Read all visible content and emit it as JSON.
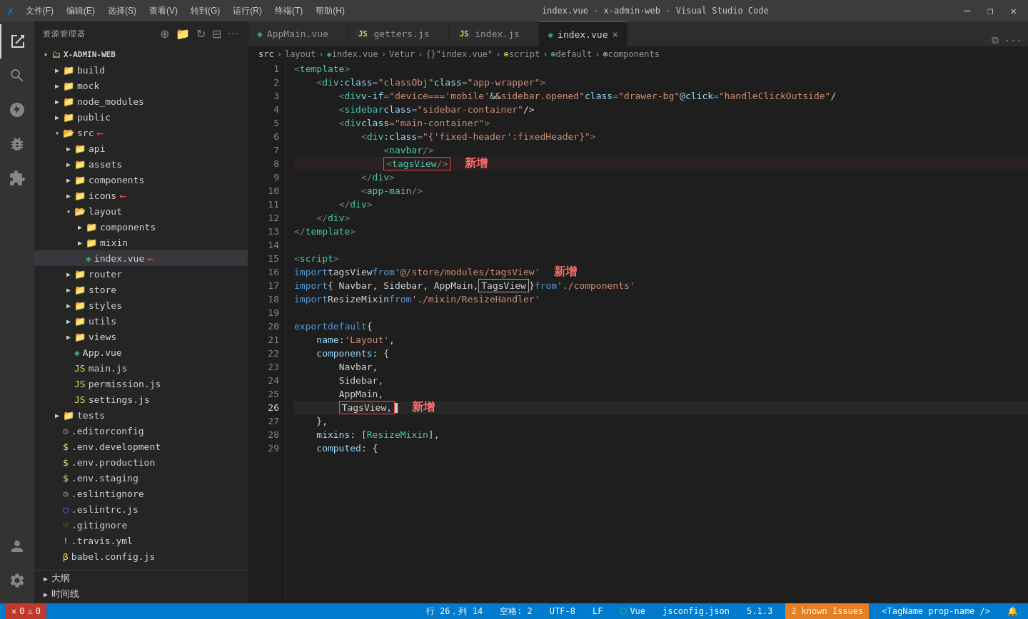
{
  "titlebar": {
    "logo": "✗",
    "menu": [
      "文件(F)",
      "编辑(E)",
      "选择(S)",
      "查看(V)",
      "转到(G)",
      "运行(R)",
      "终端(T)",
      "帮助(H)"
    ],
    "title": "index.vue - x-admin-web - Visual Studio Code",
    "window_controls": [
      "⬜",
      "❐",
      "⬜",
      "✕"
    ]
  },
  "sidebar": {
    "title": "资源管理器",
    "root": "X-ADMIN-WEB",
    "items": [
      {
        "id": "build",
        "label": "build",
        "type": "folder",
        "indent": 1,
        "collapsed": true
      },
      {
        "id": "mock",
        "label": "mock",
        "type": "folder",
        "indent": 1,
        "collapsed": true
      },
      {
        "id": "node_modules",
        "label": "node_modules",
        "type": "folder",
        "indent": 1,
        "collapsed": true
      },
      {
        "id": "public",
        "label": "public",
        "type": "folder",
        "indent": 1,
        "collapsed": true
      },
      {
        "id": "src",
        "label": "src",
        "type": "folder",
        "indent": 1,
        "collapsed": false
      },
      {
        "id": "api",
        "label": "api",
        "type": "folder",
        "indent": 2,
        "collapsed": true
      },
      {
        "id": "assets",
        "label": "assets",
        "type": "folder",
        "indent": 2,
        "collapsed": true
      },
      {
        "id": "components",
        "label": "components",
        "type": "folder",
        "indent": 2,
        "collapsed": true
      },
      {
        "id": "icons",
        "label": "icons",
        "type": "folder",
        "indent": 2,
        "collapsed": true
      },
      {
        "id": "layout",
        "label": "layout",
        "type": "folder",
        "indent": 2,
        "collapsed": false
      },
      {
        "id": "layout-components",
        "label": "components",
        "type": "folder",
        "indent": 3,
        "collapsed": true
      },
      {
        "id": "layout-mixin",
        "label": "mixin",
        "type": "folder",
        "indent": 3,
        "collapsed": true
      },
      {
        "id": "index.vue",
        "label": "index.vue",
        "type": "vue",
        "indent": 3,
        "active": true
      },
      {
        "id": "router",
        "label": "router",
        "type": "folder",
        "indent": 2,
        "collapsed": true
      },
      {
        "id": "store",
        "label": "store",
        "type": "folder",
        "indent": 2,
        "collapsed": true
      },
      {
        "id": "styles",
        "label": "styles",
        "type": "folder",
        "indent": 2,
        "collapsed": true
      },
      {
        "id": "utils",
        "label": "utils",
        "type": "folder",
        "indent": 2,
        "collapsed": true
      },
      {
        "id": "views",
        "label": "views",
        "type": "folder",
        "indent": 2,
        "collapsed": true
      },
      {
        "id": "App.vue",
        "label": "App.vue",
        "type": "vue",
        "indent": 2
      },
      {
        "id": "main.js",
        "label": "main.js",
        "type": "js",
        "indent": 2
      },
      {
        "id": "permission.js",
        "label": "permission.js",
        "type": "js",
        "indent": 2
      },
      {
        "id": "settings.js",
        "label": "settings.js",
        "type": "js",
        "indent": 2
      },
      {
        "id": "tests",
        "label": "tests",
        "type": "folder",
        "indent": 1,
        "collapsed": true
      },
      {
        "id": ".editorconfig",
        "label": ".editorconfig",
        "type": "config",
        "indent": 1
      },
      {
        "id": ".env.development",
        "label": ".env.development",
        "type": "env",
        "indent": 1
      },
      {
        "id": ".env.production",
        "label": ".env.production",
        "type": "env",
        "indent": 1
      },
      {
        "id": ".env.staging",
        "label": ".env.staging",
        "type": "env",
        "indent": 1
      },
      {
        "id": ".eslintignore",
        "label": ".eslintignore",
        "type": "config",
        "indent": 1
      },
      {
        "id": ".eslintrc.js",
        "label": ".eslintrc.js",
        "type": "eslint",
        "indent": 1
      },
      {
        "id": ".gitignore",
        "label": ".gitignore",
        "type": "git",
        "indent": 1
      },
      {
        "id": ".travis.yml",
        "label": ".travis.yml",
        "type": "travis",
        "indent": 1
      },
      {
        "id": "babel.config.js",
        "label": "babel.config.js",
        "type": "babel",
        "indent": 1
      }
    ],
    "bottom_items": [
      "大纲",
      "时间线"
    ]
  },
  "tabs": [
    {
      "id": "AppMain.vue",
      "label": "AppMain.vue",
      "type": "vue",
      "active": false
    },
    {
      "id": "getters.js",
      "label": "getters.js",
      "type": "js",
      "active": false
    },
    {
      "id": "index.js",
      "label": "index.js",
      "type": "js",
      "active": false
    },
    {
      "id": "index.vue",
      "label": "index.vue",
      "type": "vue",
      "active": true
    }
  ],
  "breadcrumb": {
    "parts": [
      "src",
      ">",
      "layout",
      ">",
      "index.vue",
      ">",
      "Vetur",
      ">",
      "{}",
      "\"index.vue\"",
      ">",
      "⊕",
      "script",
      ">",
      "⊕",
      "default",
      ">",
      "⊗",
      "components"
    ]
  },
  "code": {
    "lines": [
      {
        "num": 1,
        "content": "<template>",
        "type": "template"
      },
      {
        "num": 2,
        "content": "    <div :class=\"classObj\" class=\"app-wrapper\">",
        "type": "code"
      },
      {
        "num": 3,
        "content": "        <div v-if=\"device==='mobile'&&sidebar.opened\" class=\"drawer-bg\" @click=\"handleClickOutside\" /",
        "type": "code"
      },
      {
        "num": 4,
        "content": "        <sidebar class=\"sidebar-container\" />",
        "type": "code"
      },
      {
        "num": 5,
        "content": "        <div class=\"main-container\">",
        "type": "code"
      },
      {
        "num": 6,
        "content": "            <div :class=\"{'fixed-header':fixedHeader}\">",
        "type": "code"
      },
      {
        "num": 7,
        "content": "                <navbar />",
        "type": "code"
      },
      {
        "num": 8,
        "content": "                <tagsView/>",
        "type": "code",
        "highlight": true,
        "annotation": "新增"
      },
      {
        "num": 9,
        "content": "            </div>",
        "type": "code"
      },
      {
        "num": 10,
        "content": "            <app-main />",
        "type": "code"
      },
      {
        "num": 11,
        "content": "        </div>",
        "type": "code"
      },
      {
        "num": 12,
        "content": "    </div>",
        "type": "code"
      },
      {
        "num": 13,
        "content": "</template>",
        "type": "code"
      },
      {
        "num": 14,
        "content": "",
        "type": "empty"
      },
      {
        "num": 15,
        "content": "<script>",
        "type": "code"
      },
      {
        "num": 16,
        "content": "import tagsView from '@/store/modules/tagsView'",
        "type": "code",
        "annotation": "新增"
      },
      {
        "num": 17,
        "content": "import { Navbar, Sidebar, AppMain, TagsView } from './components'",
        "type": "code",
        "highlight17": true
      },
      {
        "num": 18,
        "content": "import ResizeMixin from './mixin/ResizeHandler'",
        "type": "code"
      },
      {
        "num": 19,
        "content": "",
        "type": "empty"
      },
      {
        "num": 20,
        "content": "export default {",
        "type": "code"
      },
      {
        "num": 21,
        "content": "    name: 'Layout',",
        "type": "code"
      },
      {
        "num": 22,
        "content": "    components: {",
        "type": "code"
      },
      {
        "num": 23,
        "content": "        Navbar,",
        "type": "code"
      },
      {
        "num": 24,
        "content": "        Sidebar,",
        "type": "code"
      },
      {
        "num": 25,
        "content": "        AppMain,",
        "type": "code"
      },
      {
        "num": 26,
        "content": "        TagsView,",
        "type": "code",
        "active": true,
        "annotation": "新增"
      },
      {
        "num": 27,
        "content": "    },",
        "type": "code"
      },
      {
        "num": 28,
        "content": "    mixins: [ResizeMixin],",
        "type": "code"
      },
      {
        "num": 29,
        "content": "    computed: {",
        "type": "code"
      }
    ]
  },
  "status": {
    "errors": "0",
    "warnings": "0",
    "position": "行 26，列 14",
    "spaces": "空格: 2",
    "encoding": "UTF-8",
    "line_ending": "LF",
    "language": "Vue",
    "config": "jsconfig.json",
    "version": "5.1.3",
    "known_issues": "2 known Issues",
    "tag_name": "<TagName prop-name />"
  }
}
